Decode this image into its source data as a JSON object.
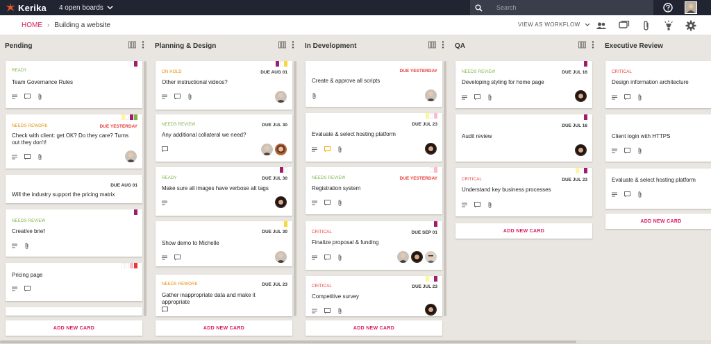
{
  "app": {
    "name": "Kerika",
    "boards_label": "4 open boards",
    "search_placeholder": "Search"
  },
  "breadcrumb": {
    "home": "HOME",
    "board": "Building a website"
  },
  "toolbar": {
    "view_as": "VIEW AS WORKFLOW"
  },
  "colors": {
    "topbar": "#212431",
    "accent": "#d81b60",
    "ready": "#7cb342",
    "on_hold": "#e58a00",
    "needs_review": "#7cb342",
    "needs_rework": "#e58a00",
    "critical": "#e53935",
    "due_red": "#e53935"
  },
  "add_card_label": "ADD NEW CARD",
  "columns": [
    {
      "title": "Pending",
      "cards": [
        {
          "status": "READY",
          "due": "",
          "title": "Team Governance Rules"
        },
        {
          "status": "NEEDS REWORK",
          "due": "DUE YESTERDAY",
          "title": "Check with client: get OK? Do they care?  Turns out they don't!"
        },
        {
          "status": "",
          "due": "DUE AUG 01",
          "title": "Will the industry support the pricing matrix"
        },
        {
          "status": "NEEDS REVIEW",
          "due": "",
          "title": "Creative brief"
        },
        {
          "status": "",
          "due": "",
          "title": "Pricing page"
        }
      ]
    },
    {
      "title": "Planning & Design",
      "cards": [
        {
          "status": "ON HOLD",
          "due": "DUE AUG 01",
          "title": "Other instructional videos?"
        },
        {
          "status": "NEEDS REVIEW",
          "due": "DUE JUL 30",
          "title": "Any additional collateral we need?"
        },
        {
          "status": "READY",
          "due": "DUE JUL 30",
          "title": "Make sure all images have verbose alt tags"
        },
        {
          "status": "",
          "due": "DUE JUL 30",
          "title": "Show demo to Michelle"
        },
        {
          "status": "NEEDS REWORK",
          "due": "DUE JUL 23",
          "title": "Gather inappropriate data and make it appropriate"
        }
      ]
    },
    {
      "title": "In Development",
      "cards": [
        {
          "status": "",
          "due": "DUE YESTERDAY",
          "title": "Create & approve all scripts"
        },
        {
          "status": "",
          "due": "DUE JUL 23",
          "title": "Evaluate & select hosting platform"
        },
        {
          "status": "NEEDS REVIEW",
          "due": "DUE YESTERDAY",
          "title": "Registration system"
        },
        {
          "status": "CRITICAL",
          "due": "DUE SEP 01",
          "title": "Finalize proposal & funding"
        },
        {
          "status": "CRITICAL",
          "due": "DUE JUL 23",
          "title": "Competitive survey"
        }
      ]
    },
    {
      "title": "QA",
      "cards": [
        {
          "status": "NEEDS REVIEW",
          "due": "DUE JUL 16",
          "title": "Developing styling for home page"
        },
        {
          "status": "",
          "due": "DUE JUL 16",
          "title": "Audit review"
        },
        {
          "status": "CRITICAL",
          "due": "DUE JUL 23",
          "title": "Understand key business processes"
        }
      ]
    },
    {
      "title": "Executive Review",
      "cards": [
        {
          "status": "CRITICAL",
          "due": "",
          "title": "Design information architecture"
        },
        {
          "status": "",
          "due": "",
          "title": "Client login with HTTPS"
        },
        {
          "status": "",
          "due": "",
          "title": "Evaluate & select hosting platform"
        }
      ]
    }
  ]
}
